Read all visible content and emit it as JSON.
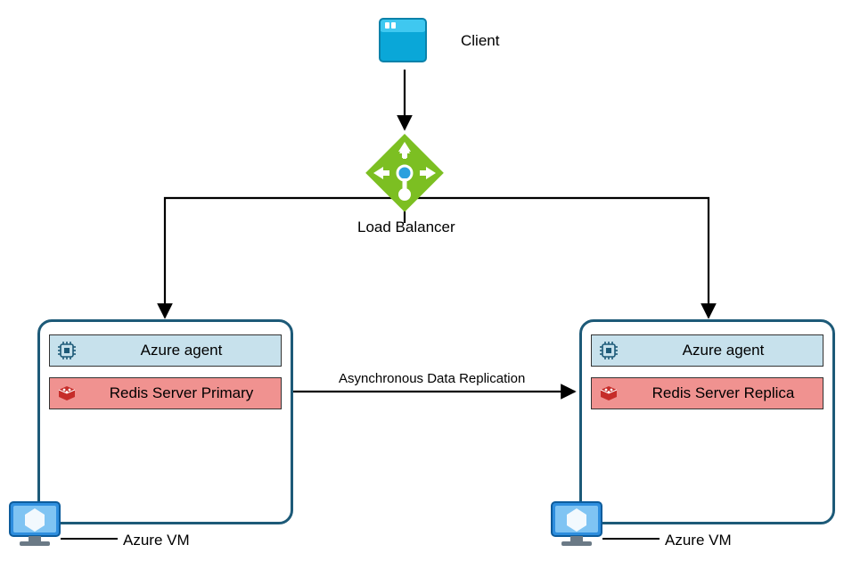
{
  "labels": {
    "client": "Client",
    "load_balancer": "Load Balancer",
    "azure_agent": "Azure agent",
    "redis_primary": "Redis Server Primary",
    "redis_replica": "Redis Server Replica",
    "replication": "Asynchronous Data Replication",
    "azure_vm": "Azure VM"
  },
  "architecture": {
    "client": {
      "connects_to": "load_balancer"
    },
    "load_balancer": {
      "balances_to": [
        "vm_primary",
        "vm_replica"
      ]
    },
    "vm_primary": {
      "type": "Azure VM",
      "contains": [
        "Azure agent",
        "Redis Server Primary"
      ]
    },
    "vm_replica": {
      "type": "Azure VM",
      "contains": [
        "Azure agent",
        "Redis Server Replica"
      ]
    },
    "replication": {
      "from": "Redis Server Primary",
      "to": "Redis Server Replica",
      "mode": "Asynchronous"
    }
  }
}
